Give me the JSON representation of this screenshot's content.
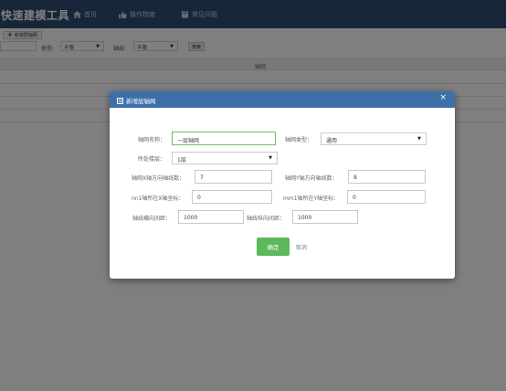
{
  "nav": {
    "brand": "快速建模工具",
    "items": [
      {
        "label": "首页",
        "icon": "home-icon"
      },
      {
        "label": "操作指南",
        "icon": "thumbs-up-icon"
      },
      {
        "label": "常见问题",
        "icon": "book-icon"
      }
    ]
  },
  "toolbar": {
    "add_label": "新增层轴网",
    "type_label": "类型:",
    "type_value": "不限",
    "floor_label": "轴层:",
    "floor_value": "不限",
    "search_label": "搜索"
  },
  "grid": {
    "header": "轴网"
  },
  "modal": {
    "title": "新增层轴网",
    "close_glyph": "×",
    "fields": {
      "grid_name_label": "轴网名称：",
      "grid_name_value": "一层轴网",
      "grid_type_label": "轴网类型：",
      "grid_type_value": "通用",
      "floor_label": "所处楼层：",
      "floor_value": "1层",
      "x_count_label": "轴网X轴方向轴线数：",
      "x_count_value": "7",
      "y_count_label": "轴网Y轴方向轴线数：",
      "y_count_value": "8",
      "nn1_label": "nn1轴所在X轴坐标：",
      "nn1_value": "0",
      "mm1_label": "mm1轴所在Y轴坐标：",
      "mm1_value": "0",
      "h_spacing_label": "轴线横向间距：",
      "h_spacing_value": "1000",
      "v_spacing_label": "轴线纵向间距：",
      "v_spacing_value": "1000"
    },
    "ok_label": "确定",
    "cancel_label": "取消"
  },
  "colors": {
    "nav_bg": "#2e4f72",
    "modal_header": "#3d70a8",
    "ok_button": "#5cb85c"
  }
}
